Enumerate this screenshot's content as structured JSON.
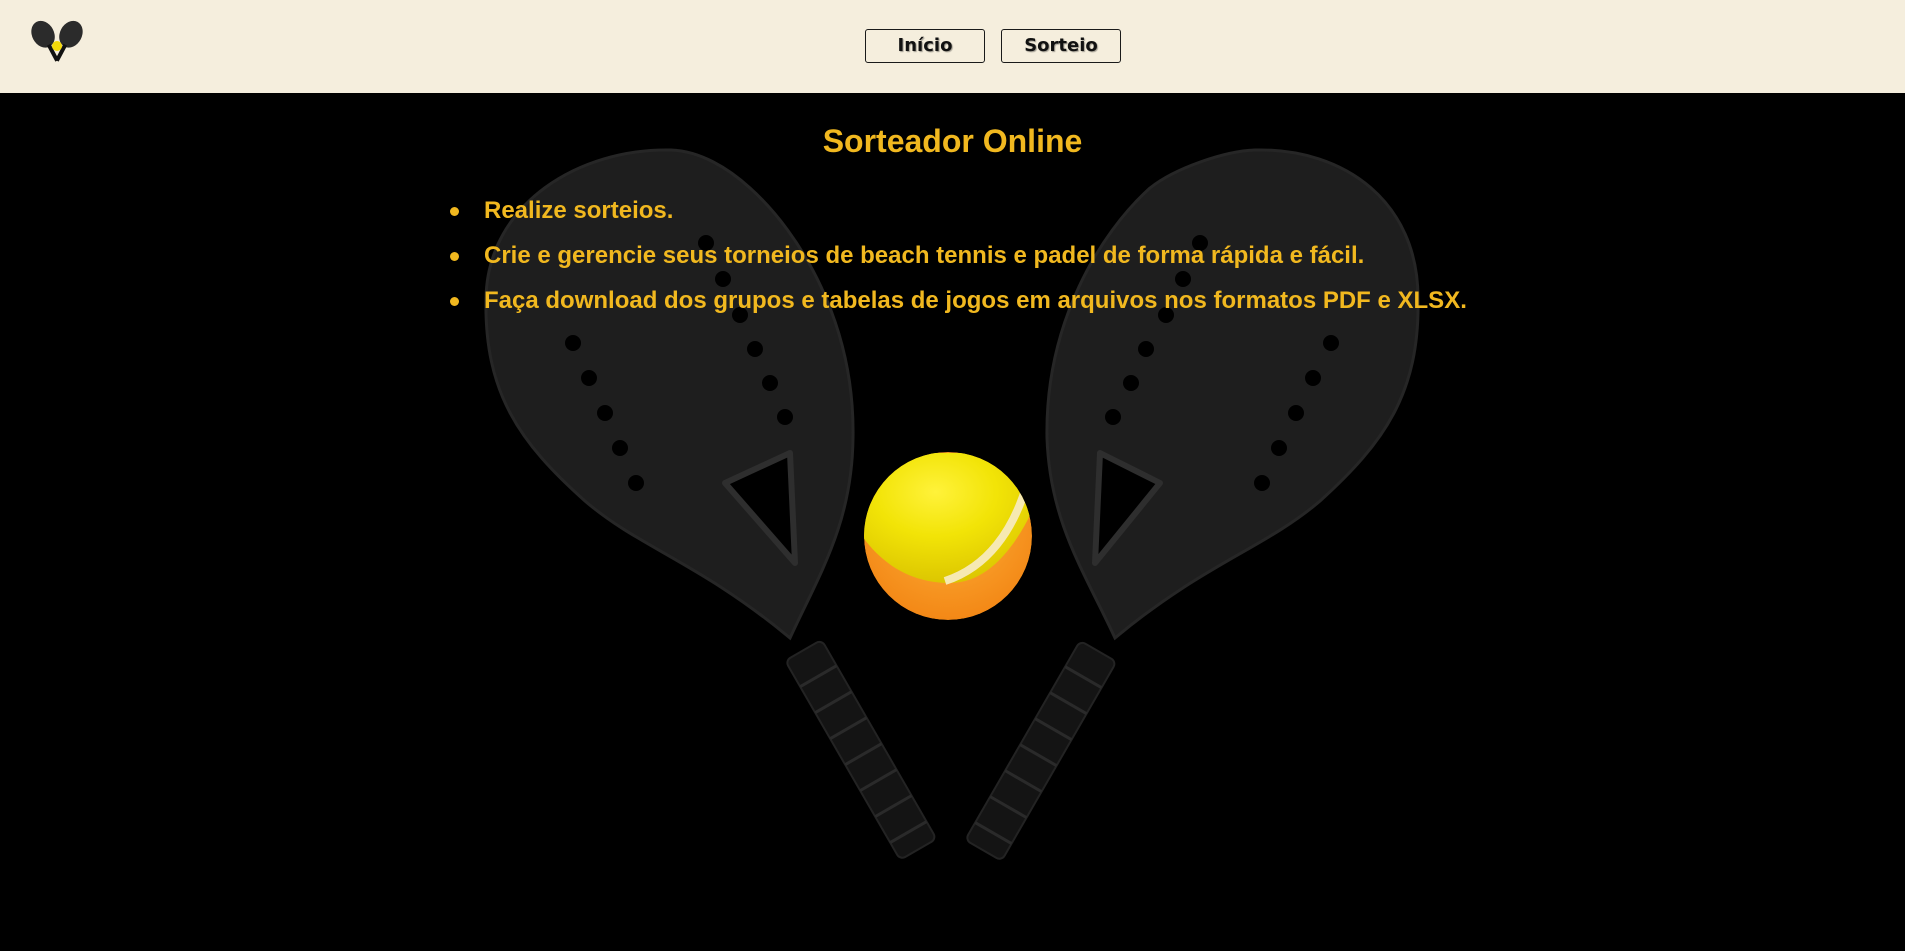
{
  "header": {
    "logo_icon": "crossed-rackets-logo-icon",
    "nav": [
      {
        "label": "Início"
      },
      {
        "label": "Sorteio"
      }
    ]
  },
  "main": {
    "title": "Sorteador Online",
    "features": [
      "Realize sorteios.",
      "Crie e gerencie seus torneios de beach tennis e padel de forma rápida e fácil.",
      "Faça download dos grupos e tabelas de jogos em arquivos nos formatos PDF e XLSX."
    ],
    "background_icons": [
      "beach-tennis-rackets-icon",
      "tennis-ball-icon"
    ]
  },
  "colors": {
    "header_bg": "#f5eedd",
    "main_bg": "#000000",
    "accent": "#f1b81f"
  }
}
